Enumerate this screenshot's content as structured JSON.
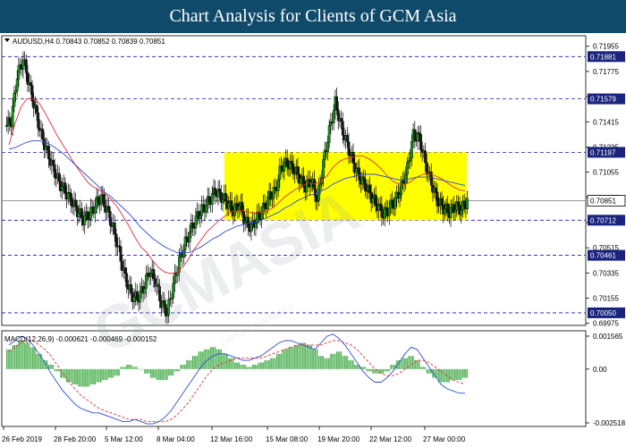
{
  "banner": {
    "title": "Chart Analysis for Clients of GCM Asia",
    "bg": "#0f4a6b"
  },
  "chart_data": {
    "type": "candlestick",
    "symbol_line": "AUDUSD,H4  0.70843 0.70852 0.70839 0.70851",
    "price_axis": {
      "ticks": [
        "0.71955",
        "0.71775",
        "0.71595",
        "0.71415",
        "0.71235",
        "0.71055",
        "0.70875",
        "0.70695",
        "0.70515",
        "0.70335",
        "0.70155",
        "0.69975"
      ],
      "ylim": [
        0.6996,
        0.7203
      ]
    },
    "time_axis": [
      "26 Feb 2019",
      "28 Feb 20:00",
      "5 Mar 12:00",
      "8 Mar 04:00",
      "12 Mar 16:00",
      "15 Mar 08:00",
      "19 Mar 20:00",
      "22 Mar 12:00",
      "27 Mar 00:00"
    ],
    "levels": [
      {
        "value": 0.71881,
        "label": "0.71881"
      },
      {
        "value": 0.71579,
        "label": "0.71579"
      },
      {
        "value": 0.71197,
        "label": "0.71197"
      },
      {
        "value": 0.70712,
        "label": "0.70712"
      },
      {
        "value": 0.70461,
        "label": "0.70461"
      },
      {
        "value": 0.7005,
        "label": "0.70050"
      }
    ],
    "current_price": {
      "value": 0.70851,
      "label": "0.70851"
    },
    "box": {
      "price_top": 0.71197,
      "price_bottom": 0.70712,
      "color": "#ffff00"
    },
    "closes": [
      0.7142,
      0.7175,
      0.7186,
      0.7168,
      0.715,
      0.7132,
      0.712,
      0.7108,
      0.7098,
      0.7092,
      0.7085,
      0.7078,
      0.7072,
      0.7075,
      0.7082,
      0.7088,
      0.7078,
      0.7065,
      0.7048,
      0.703,
      0.7018,
      0.7015,
      0.7022,
      0.7035,
      0.7028,
      0.7012,
      0.7005,
      0.7025,
      0.7042,
      0.7055,
      0.7065,
      0.7074,
      0.708,
      0.7085,
      0.7092,
      0.7088,
      0.7084,
      0.7078,
      0.7083,
      0.707,
      0.7066,
      0.7073,
      0.7079,
      0.7088,
      0.7092,
      0.711,
      0.7112,
      0.7108,
      0.7102,
      0.7095,
      0.71,
      0.7085,
      0.7112,
      0.7135,
      0.7155,
      0.7138,
      0.7125,
      0.7112,
      0.7102,
      0.7096,
      0.7088,
      0.7082,
      0.7075,
      0.708,
      0.7085,
      0.7095,
      0.7108,
      0.7132,
      0.713,
      0.7112,
      0.7098,
      0.7085,
      0.708,
      0.7077,
      0.7081,
      0.7079,
      0.7085
    ],
    "ma_red": [
      0.7125,
      0.714,
      0.7152,
      0.7158,
      0.7158,
      0.7155,
      0.7148,
      0.714,
      0.7132,
      0.7125,
      0.7118,
      0.7111,
      0.7105,
      0.7099,
      0.7095,
      0.7093,
      0.709,
      0.7086,
      0.7081,
      0.7074,
      0.7067,
      0.7059,
      0.7052,
      0.7048,
      0.7042,
      0.7037,
      0.7034,
      0.7033,
      0.7034,
      0.7038,
      0.7044,
      0.7051,
      0.7057,
      0.7063,
      0.7067,
      0.7071,
      0.7074,
      0.7077,
      0.7078,
      0.7078,
      0.7077,
      0.7076,
      0.7077,
      0.7078,
      0.708,
      0.7084,
      0.7088,
      0.7091,
      0.7094,
      0.7096,
      0.7098,
      0.7097,
      0.7099,
      0.7103,
      0.7109,
      0.7113,
      0.7115,
      0.7116,
      0.7117,
      0.7117,
      0.7115,
      0.7112,
      0.7108,
      0.7103,
      0.7099,
      0.7097,
      0.7097,
      0.7099,
      0.7102,
      0.7104,
      0.7105,
      0.7103,
      0.7101,
      0.7098,
      0.7095,
      0.7093,
      0.7092
    ],
    "ma_blue": [
      0.7122,
      0.7123,
      0.7125,
      0.7127,
      0.7128,
      0.7128,
      0.7127,
      0.7125,
      0.7122,
      0.7119,
      0.7115,
      0.7111,
      0.7107,
      0.7103,
      0.7099,
      0.7095,
      0.7091,
      0.7088,
      0.7084,
      0.708,
      0.7076,
      0.7071,
      0.7066,
      0.7062,
      0.7058,
      0.7055,
      0.7052,
      0.705,
      0.7048,
      0.7048,
      0.7048,
      0.705,
      0.7052,
      0.7055,
      0.7058,
      0.706,
      0.7063,
      0.7065,
      0.7067,
      0.7068,
      0.7069,
      0.707,
      0.7071,
      0.7073,
      0.7075,
      0.7077,
      0.708,
      0.7082,
      0.7085,
      0.7087,
      0.7089,
      0.709,
      0.7092,
      0.7094,
      0.7097,
      0.7099,
      0.7101,
      0.7102,
      0.7103,
      0.7104,
      0.7104,
      0.7104,
      0.7103,
      0.7102,
      0.7101,
      0.71,
      0.71,
      0.7101,
      0.7102,
      0.7102,
      0.7102,
      0.7101,
      0.71,
      0.7099,
      0.7098,
      0.7097,
      0.7096
    ],
    "macd": {
      "label": "MACD(12,26,9) -0.000621 -0.000469 -0.000152",
      "ticks": [
        "0.001565",
        "0.00",
        "-0.002518"
      ],
      "ylim": [
        -0.00262,
        0.00175
      ],
      "hist": [
        0.0009,
        0.0011,
        0.0013,
        0.0012,
        0.001,
        0.0007,
        0.0004,
        0.0002,
        -0.0001,
        -0.0004,
        -0.0006,
        -0.0007,
        -0.0008,
        -0.0008,
        -0.0007,
        -0.0006,
        -0.0005,
        -0.0004,
        -0.0003,
        0.0001,
        0.0002,
        0.0001,
        0.0,
        -0.0002,
        -0.0004,
        -0.0005,
        -0.0005,
        -0.0003,
        -0.0001,
        0.0002,
        0.0004,
        0.0006,
        0.0008,
        0.0009,
        0.001,
        0.0009,
        0.0007,
        0.0005,
        0.0003,
        0.0002,
        0.0001,
        0.0002,
        0.0003,
        0.0004,
        0.0005,
        0.0007,
        0.0009,
        0.001,
        0.0011,
        0.0012,
        0.0011,
        0.0009,
        0.0006,
        0.0005,
        0.0007,
        0.0008,
        0.0006,
        0.0004,
        0.0002,
        0.0001,
        -0.0001,
        -0.0002,
        -0.0002,
        -0.0001,
        0.0002,
        0.0004,
        0.0005,
        0.0006,
        0.0004,
        0.0001,
        -0.0002,
        -0.0004,
        -0.0006,
        -0.0006,
        -0.0005,
        -0.0005,
        -0.0004
      ],
      "line": [
        0.0011,
        0.0013,
        0.0015,
        0.0014,
        0.0011,
        0.0007,
        0.0003,
        -0.0002,
        -0.0006,
        -0.001,
        -0.0013,
        -0.0016,
        -0.0018,
        -0.0019,
        -0.002,
        -0.002,
        -0.0021,
        -0.0022,
        -0.0023,
        -0.0024,
        -0.0024,
        -0.0023,
        -0.0024,
        -0.0025,
        -0.0025,
        -0.0024,
        -0.0022,
        -0.0019,
        -0.0015,
        -0.0011,
        -0.0007,
        -0.0003,
        0.0001,
        0.0004,
        0.0006,
        0.0007,
        0.0007,
        0.0006,
        0.0005,
        0.0004,
        0.0004,
        0.0005,
        0.0006,
        0.0008,
        0.001,
        0.0012,
        0.0013,
        0.0013,
        0.0012,
        0.0011,
        0.001,
        0.0009,
        0.0012,
        0.0015,
        0.0016,
        0.0014,
        0.0011,
        0.0007,
        0.0003,
        -0.0001,
        -0.0004,
        -0.0006,
        -0.0006,
        -0.0004,
        -0.0001,
        0.0003,
        0.0007,
        0.001,
        0.0009,
        0.0005,
        0.0001,
        -0.0003,
        -0.0007,
        -0.0009,
        -0.001,
        -0.0011,
        -0.0011
      ],
      "signal": [
        0.0008,
        0.001,
        0.0012,
        0.0013,
        0.0013,
        0.0011,
        0.0009,
        0.0006,
        0.0002,
        -0.0002,
        -0.0006,
        -0.0009,
        -0.0012,
        -0.0014,
        -0.0016,
        -0.0018,
        -0.0019,
        -0.002,
        -0.0021,
        -0.0022,
        -0.0023,
        -0.0023,
        -0.0023,
        -0.0024,
        -0.0024,
        -0.0024,
        -0.0024,
        -0.0023,
        -0.0021,
        -0.0018,
        -0.0015,
        -0.0011,
        -0.0007,
        -0.0003,
        0.0,
        0.0002,
        0.0003,
        0.0004,
        0.0005,
        0.0005,
        0.0005,
        0.0005,
        0.0005,
        0.0006,
        0.0007,
        0.0008,
        0.0009,
        0.001,
        0.0011,
        0.0011,
        0.0011,
        0.0011,
        0.0011,
        0.0012,
        0.0013,
        0.0013,
        0.0012,
        0.0011,
        0.0009,
        0.0006,
        0.0003,
        0.0,
        -0.0002,
        -0.0003,
        -0.0003,
        -0.0002,
        0.0,
        0.0002,
        0.0004,
        0.0004,
        0.0003,
        0.0001,
        -0.0001,
        -0.0003,
        -0.0005,
        -0.0006,
        -0.0007
      ]
    },
    "watermark": {
      "text": "GCMASIA",
      "sub": "GLOBAL CAPITAL MARKETS"
    },
    "colors": {
      "up": "#1a9e1a",
      "down": "#1a1a1a",
      "ma_red": "#e0303a",
      "ma_blue": "#2a4fd6",
      "level_line": "#1a1aa8",
      "label_bg": "#1a237e",
      "macd_hist": "#4caf50",
      "macd_line": "#2a4fd6",
      "macd_signal": "#e0303a"
    }
  }
}
